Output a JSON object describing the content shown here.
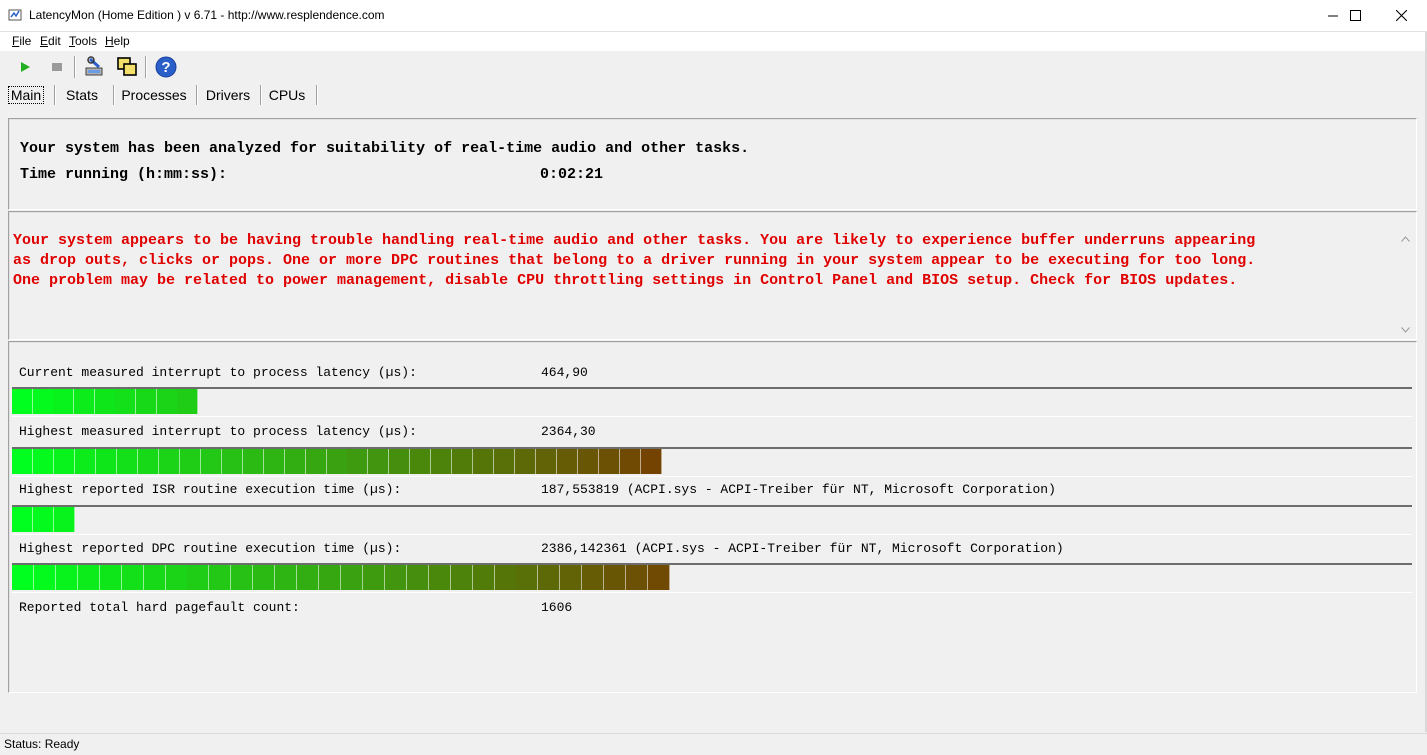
{
  "window": {
    "title": "LatencyMon  (Home Edition )  v 6.71 - http://www.resplendence.com",
    "app_icon": "latencymon-icon",
    "controls": [
      "minimize-icon",
      "maximize-icon",
      "close-icon"
    ]
  },
  "menu": {
    "items": [
      {
        "label": "File"
      },
      {
        "label": "Edit"
      },
      {
        "label": "Tools"
      },
      {
        "label": "Help"
      }
    ]
  },
  "toolbar": {
    "buttons": [
      {
        "icon": "play-icon",
        "color": "#22b022"
      },
      {
        "icon": "stop-icon",
        "color": "#9a9a9a"
      },
      {
        "icon": "analyze-tools-icon"
      },
      {
        "icon": "windows-icon"
      },
      {
        "icon": "help-icon",
        "color": "#2a5fc9"
      }
    ]
  },
  "tabs": [
    {
      "label": "Main",
      "active": true
    },
    {
      "label": "Stats"
    },
    {
      "label": "Processes"
    },
    {
      "label": "Drivers"
    },
    {
      "label": "CPUs"
    }
  ],
  "summary": {
    "analyzed_text": "Your system has been analyzed for suitability of real-time audio and other tasks.",
    "time_label": "Time running (h:mm:ss):",
    "time_value": "0:02:21"
  },
  "verdict": {
    "text_lines": [
      "Your system appears to be having trouble handling real-time audio and other tasks. You are likely to experience buffer underruns appearing",
      "as drop outs, clicks or pops. One or more DPC routines that belong to a driver running in your system appear to be executing for too long.",
      "One problem may be related to power management, disable CPU throttling settings in Control Panel and BIOS setup. Check for BIOS updates."
    ],
    "color": "#e00000"
  },
  "metrics": [
    {
      "label": "Current measured interrupt to process latency (µs):",
      "value": "464,90",
      "segments": 9,
      "fill_fraction": 0.133
    },
    {
      "label": "Highest measured interrupt to process latency (µs):",
      "value": "2364,30",
      "segments": 31,
      "fill_fraction": 0.464
    },
    {
      "label": "Highest reported ISR routine execution time (µs):",
      "value": "187,553819  (ACPI.sys - ACPI-Treiber für NT, Microsoft Corporation)",
      "segments": 3,
      "fill_fraction": 0.045
    },
    {
      "label": "Highest reported DPC routine execution time (µs):",
      "value": "2386,142361  (ACPI.sys - ACPI-Treiber für NT, Microsoft Corporation)",
      "segments": 30,
      "fill_fraction": 0.47
    },
    {
      "label": "Reported total hard pagefault count:",
      "value": "1606"
    }
  ],
  "meter_colors": {
    "start": "#00ff1e",
    "end": "#7a3a00"
  },
  "status": {
    "text": "Status: Ready"
  }
}
